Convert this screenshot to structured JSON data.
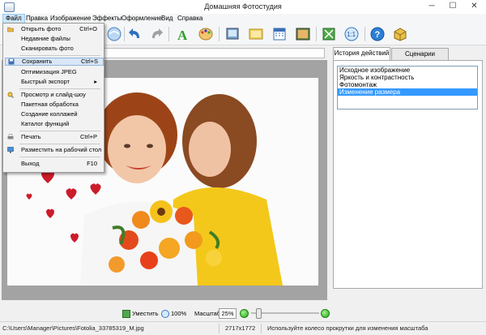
{
  "window": {
    "title": "Домашняя Фотостудия",
    "controls": {
      "minimize": "─",
      "maximize": "☐",
      "close": "✕"
    }
  },
  "menu": [
    {
      "label": "Файл"
    },
    {
      "label": "Правка"
    },
    {
      "label": "Изображение"
    },
    {
      "label": "Эффекты"
    },
    {
      "label": "Оформление"
    },
    {
      "label": "Вид"
    },
    {
      "label": "Справка"
    }
  ],
  "file_menu": {
    "items": [
      {
        "label": "Открыть фото",
        "shortcut": "Ctrl+O",
        "icon": "folder-icon"
      },
      {
        "label": "Недавние файлы",
        "shortcut": ""
      },
      {
        "label": "Сканировать фото",
        "shortcut": ""
      },
      {
        "label": "Сохранить",
        "shortcut": "Ctrl+S",
        "icon": "save-icon",
        "highlighted": true
      },
      {
        "label": "Оптимизация JPEG",
        "shortcut": ""
      },
      {
        "label": "Быстрый экспорт",
        "shortcut": "",
        "submenu": "▸"
      },
      {
        "label": "Просмотр и слайд-шоу",
        "shortcut": "",
        "icon": "magnifier-icon"
      },
      {
        "label": "Пакетная обработка",
        "shortcut": ""
      },
      {
        "label": "Создание коллажей",
        "shortcut": ""
      },
      {
        "label": "Каталог функций",
        "shortcut": ""
      },
      {
        "label": "Печать",
        "shortcut": "Ctrl+P",
        "icon": "printer-icon"
      },
      {
        "label": "Разместить на рабочий стол",
        "shortcut": "",
        "icon": "monitor-icon"
      },
      {
        "label": "Выход",
        "shortcut": "F10"
      }
    ]
  },
  "tabs": [
    {
      "label": "История действий",
      "selected": true
    },
    {
      "label": "Сценарии",
      "selected": false
    }
  ],
  "history": [
    {
      "label": "Исходное изображение"
    },
    {
      "label": "Яркость и контрастность"
    },
    {
      "label": "Фотомонтаж"
    },
    {
      "label": "Изменение размера",
      "selected": true
    }
  ],
  "zoom": {
    "fit_label": "Уместить",
    "actual_label": "100%",
    "scale_label": "Масштаб:",
    "scale_value": "25%",
    "minus": "−",
    "plus": "+"
  },
  "status": {
    "path": "C:\\Users\\Manager\\Pictures\\Fotolia_33785319_M.jpg",
    "dimensions": "2717x1772",
    "hint": "Используйте колесо прокрутки для изменения масштаба"
  },
  "colors": {
    "selection": "#3399ff",
    "menu_highlight": "#d8e6f5",
    "canvas_bg": "#a3a3a3"
  }
}
